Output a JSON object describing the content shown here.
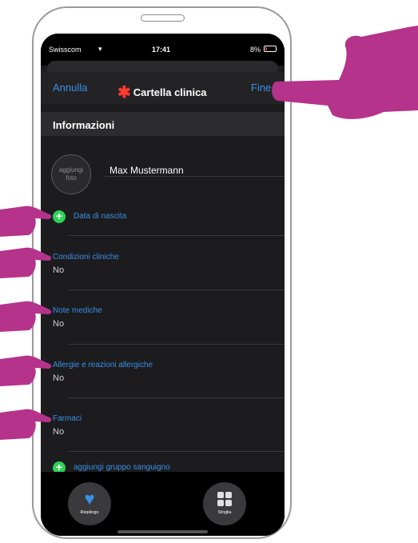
{
  "status_bar": {
    "carrier": "Swisscom",
    "time": "17:41",
    "battery": "8%"
  },
  "nav": {
    "cancel": "Annulla",
    "title": "Cartella clinica",
    "done": "Fine"
  },
  "section": {
    "title": "Informazioni"
  },
  "profile": {
    "add_photo": "aggiungi foto",
    "name": "Max Mustermann"
  },
  "add_birthdate": "Data di nascita",
  "fields": [
    {
      "label": "Condizioni cliniche",
      "value": "No"
    },
    {
      "label": "Note mediche",
      "value": "No"
    },
    {
      "label": "Allergie e reazioni allergiche",
      "value": "No"
    },
    {
      "label": "Farmaci",
      "value": "No"
    }
  ],
  "add_blood_group": "aggiungi gruppo sanguigno",
  "tabs": [
    {
      "label": "Riepilogo",
      "icon": "heart-icon"
    },
    {
      "label": "Sfoglia",
      "icon": "grid-icon"
    }
  ],
  "colors": {
    "accent": "#3b8fe8",
    "pointer": "#b5338a",
    "plus": "#30d158",
    "star": "#ff3b30"
  }
}
